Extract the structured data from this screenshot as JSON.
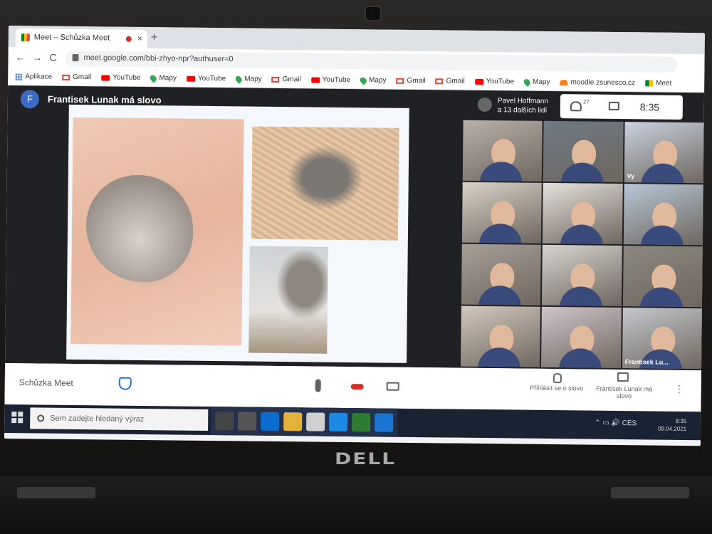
{
  "browser": {
    "tab_title": "Meet – Schůzka Meet",
    "tab_close": "×",
    "new_tab": "+",
    "nav_back": "←",
    "nav_forward": "→",
    "nav_reload": "C",
    "url": "meet.google.com/bbi-zhyo-npr?authuser=0",
    "bookmarks": [
      {
        "label": "Aplikace",
        "icon": "apps-icon"
      },
      {
        "label": "Gmail",
        "icon": "gmail-icon"
      },
      {
        "label": "YouTube",
        "icon": "youtube-icon"
      },
      {
        "label": "Mapy",
        "icon": "maps-icon"
      },
      {
        "label": "YouTube",
        "icon": "youtube-icon"
      },
      {
        "label": "Mapy",
        "icon": "maps-icon"
      },
      {
        "label": "Gmail",
        "icon": "gmail-icon"
      },
      {
        "label": "YouTube",
        "icon": "youtube-icon"
      },
      {
        "label": "Mapy",
        "icon": "maps-icon"
      },
      {
        "label": "Gmail",
        "icon": "gmail-icon"
      },
      {
        "label": "Gmail",
        "icon": "gmail-icon"
      },
      {
        "label": "YouTube",
        "icon": "youtube-icon"
      },
      {
        "label": "Mapy",
        "icon": "maps-icon"
      },
      {
        "label": "moodle.zsunesco.cz",
        "icon": "moodle-icon"
      },
      {
        "label": "Meet",
        "icon": "meet-icon"
      }
    ]
  },
  "meet": {
    "avatar_letter": "F",
    "speaker_status": "Frantisek Lunak má slovo",
    "presenter_name": "Pavel Hoffmann",
    "presenter_others": "a 13 dalších lidí",
    "participant_count": "27",
    "clock": "8:35",
    "tiles": [
      {
        "name": ""
      },
      {
        "name": ""
      },
      {
        "name": "Vy"
      },
      {
        "name": ""
      },
      {
        "name": ""
      },
      {
        "name": ""
      },
      {
        "name": ""
      },
      {
        "name": ""
      },
      {
        "name": ""
      },
      {
        "name": ""
      },
      {
        "name": ""
      },
      {
        "name": "Frantisek Lu..."
      }
    ],
    "meeting_label": "Schůzka Meet",
    "raise_hand": "Přihlásit se o slovo",
    "presenter_button": "Frantisek Lunak má slovo",
    "more": "⋮"
  },
  "taskbar": {
    "search_placeholder": "Sem zadejte hledaný výraz",
    "tray_icons": "⌃ ▭ 🔊 CES",
    "time": "8:35",
    "date": "09.04.2021"
  },
  "brand": {
    "logo": "DELL"
  },
  "colors": {
    "accent": "#1a73e8",
    "hangup": "#d93025",
    "meet_bg": "#202124"
  }
}
